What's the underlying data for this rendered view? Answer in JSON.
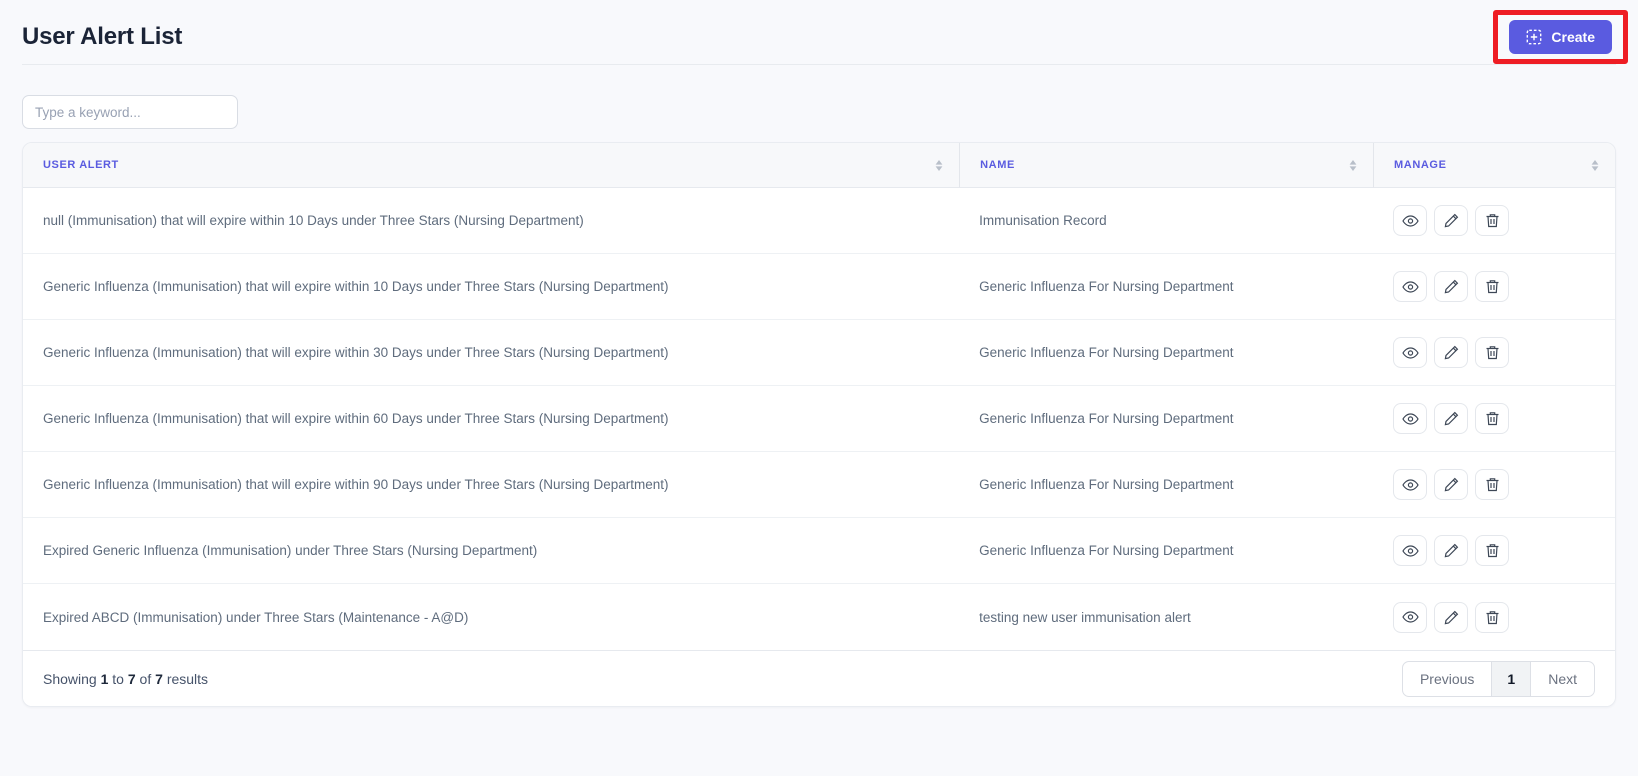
{
  "page": {
    "title": "User Alert List"
  },
  "toolbar": {
    "create_label": "Create",
    "create_icon": "plus-square-icon"
  },
  "annotation": {
    "type": "red-highlight-box"
  },
  "search": {
    "placeholder": "Type a keyword...",
    "value": ""
  },
  "table": {
    "columns": [
      {
        "label": "USER ALERT",
        "sort_icon": "sort-arrows-icon"
      },
      {
        "label": "NAME",
        "sort_icon": "sort-arrows-icon"
      },
      {
        "label": "MANAGE",
        "sort_icon": "sort-arrows-icon"
      }
    ],
    "manage_actions": [
      {
        "name": "view",
        "icon": "eye-icon"
      },
      {
        "name": "edit",
        "icon": "pencil-icon"
      },
      {
        "name": "delete",
        "icon": "trash-icon"
      }
    ],
    "rows": [
      {
        "user_alert": "null (Immunisation) that will expire within 10 Days under Three Stars (Nursing Department)",
        "name": "Immunisation Record"
      },
      {
        "user_alert": "Generic Influenza (Immunisation) that will expire within 10 Days under Three Stars (Nursing Department)",
        "name": "Generic Influenza For Nursing Department"
      },
      {
        "user_alert": "Generic Influenza (Immunisation) that will expire within 30 Days under Three Stars (Nursing Department)",
        "name": "Generic Influenza For Nursing Department"
      },
      {
        "user_alert": "Generic Influenza (Immunisation) that will expire within 60 Days under Three Stars (Nursing Department)",
        "name": "Generic Influenza For Nursing Department"
      },
      {
        "user_alert": "Generic Influenza (Immunisation) that will expire within 90 Days under Three Stars (Nursing Department)",
        "name": "Generic Influenza For Nursing Department"
      },
      {
        "user_alert": "Expired Generic Influenza (Immunisation) under Three Stars (Nursing Department)",
        "name": "Generic Influenza For Nursing Department"
      },
      {
        "user_alert": "Expired ABCD (Immunisation) under Three Stars (Maintenance - A@D)",
        "name": "testing new user immunisation alert"
      }
    ]
  },
  "pagination": {
    "showing_label": "Showing",
    "from": "1",
    "to_label": "to",
    "to": "7",
    "of_label": "of",
    "total": "7",
    "results_label": "results",
    "previous_label": "Previous",
    "page_label": "1",
    "next_label": "Next"
  },
  "colors": {
    "accent": "#5a5be0",
    "annotation": "#ee1d24",
    "title": "#1b2437",
    "muted": "#5f6c7d"
  }
}
